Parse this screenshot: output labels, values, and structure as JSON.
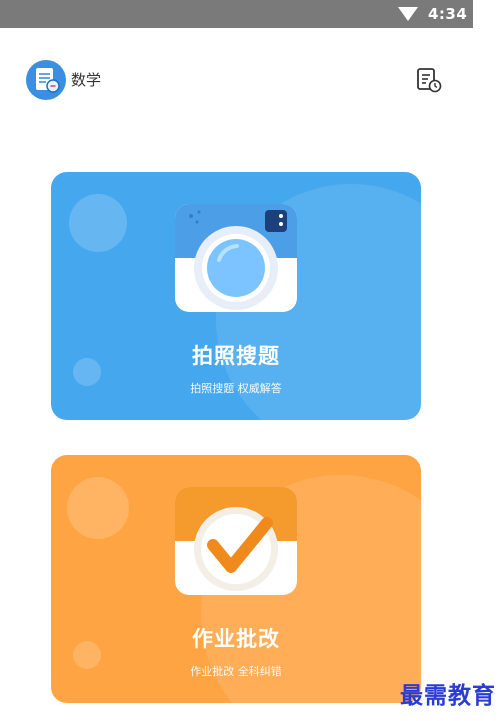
{
  "status_bar": {
    "time": "4:34"
  },
  "header": {
    "subject": "数学"
  },
  "cards": [
    {
      "title": "拍照搜题",
      "subtitle": "拍照搜题 权威解答",
      "color": "#45a8ee",
      "icon": "camera-icon"
    },
    {
      "title": "作业批改",
      "subtitle": "作业批改 全科纠错",
      "color": "#ffa443",
      "icon": "checkmark-icon"
    }
  ],
  "watermark": "最需教育",
  "colors": {
    "blue_card": "#45a8ee",
    "orange_card": "#ffa443",
    "status_bar": "#7a7a7a",
    "watermark": "#2a3cd6"
  }
}
